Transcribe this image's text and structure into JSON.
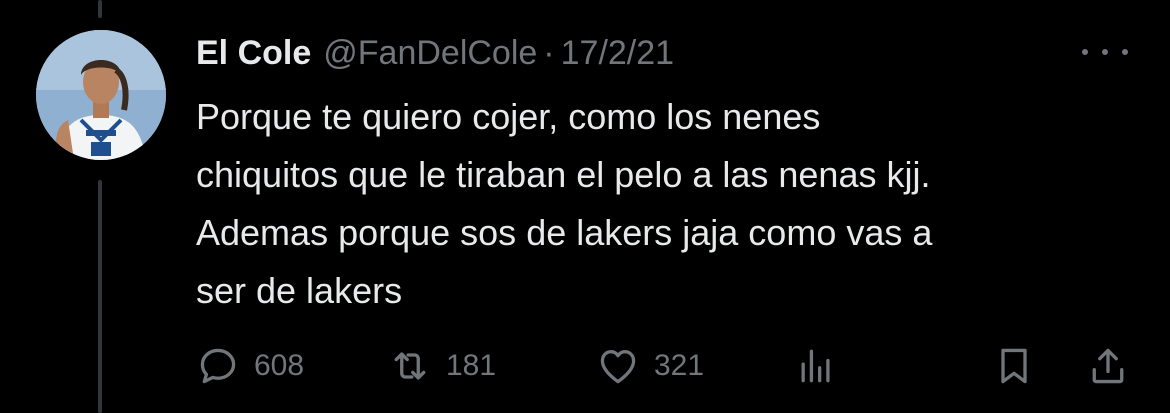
{
  "tweet": {
    "author_name": "El Cole",
    "handle": "@FanDelCole",
    "separator": "·",
    "date": "17/2/21",
    "text_lines": [
      "Porque te quiero cojer, como los nenes",
      "chiquitos que le tiraban el pelo a las nenas kjj.",
      "Ademas porque sos de lakers jaja como vas a",
      "ser de lakers"
    ]
  },
  "actions": {
    "replies": "608",
    "retweets": "181",
    "likes": "321"
  },
  "icons": {
    "more": "more-dots-icon",
    "reply": "reply-icon",
    "retweet": "retweet-icon",
    "like": "heart-icon",
    "views": "analytics-icon",
    "bookmark": "bookmark-icon",
    "share": "share-icon"
  },
  "colors": {
    "background": "#000000",
    "text_primary": "#e7e9ea",
    "text_secondary": "#71767b",
    "thread_line": "#333639"
  }
}
